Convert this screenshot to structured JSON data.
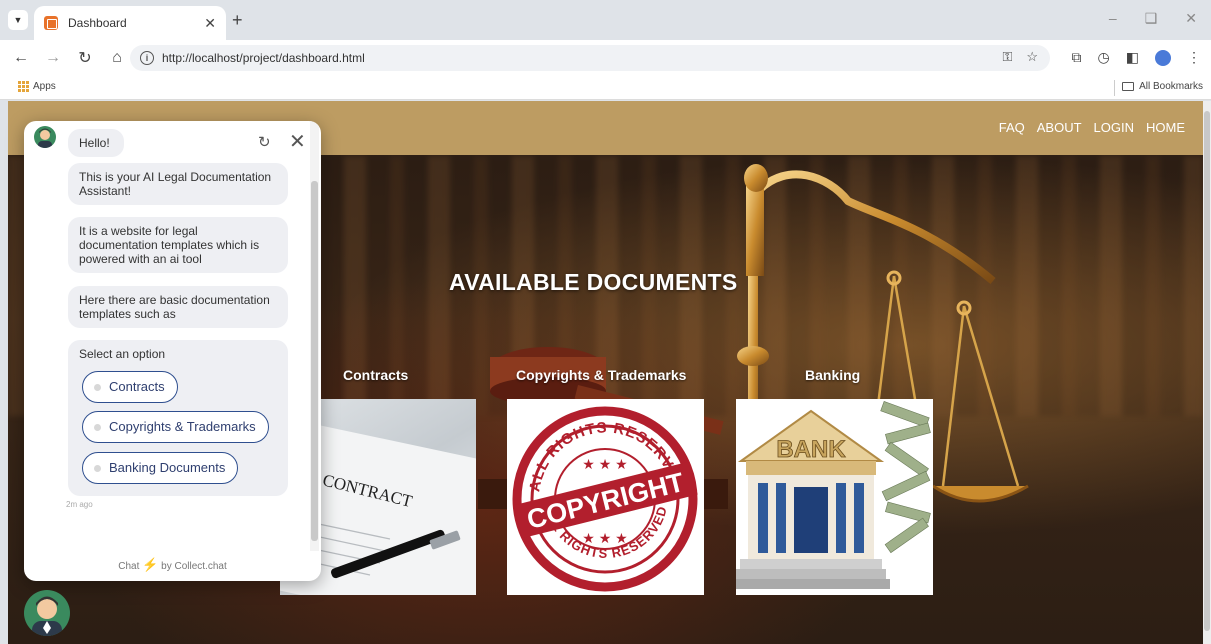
{
  "browser": {
    "tab_title": "Dashboard",
    "url": "http://localhost/project/dashboard.html",
    "bookmarks": {
      "apps_label": "Apps",
      "all_bookmarks_label": "All Bookmarks"
    }
  },
  "site": {
    "nav": [
      "FAQ",
      "ABOUT",
      "LOGIN",
      "HOME"
    ],
    "hero_title": "AVAILABLE DOCUMENTS",
    "categories": [
      "Contracts",
      "Copyrights & Trademarks",
      "Banking"
    ],
    "images": {
      "contract_text": "CONTRACT",
      "seal_top": "ALL RIGHTS RESERVED",
      "seal_center": "COPYRIGHT",
      "seal_bottom": "ALL RIGHTS RESERVED",
      "bank_text": "BANK"
    },
    "colors": {
      "header": "#bd9c62",
      "accent": "#2f4f8f",
      "seal": "#b21f2d"
    }
  },
  "chat": {
    "messages": [
      "Hello!",
      "This is your AI Legal Documentation Assistant!",
      "It is a website for legal documentation templates which is powered with an ai tool",
      "Here there are basic documentation templates such as"
    ],
    "select_prompt": "Select an option",
    "options": [
      "Contracts",
      "Copyrights & Trademarks",
      "Banking Documents"
    ],
    "time_ago": "2m ago",
    "footer_prefix": "Chat",
    "footer_suffix": "by Collect.chat"
  }
}
